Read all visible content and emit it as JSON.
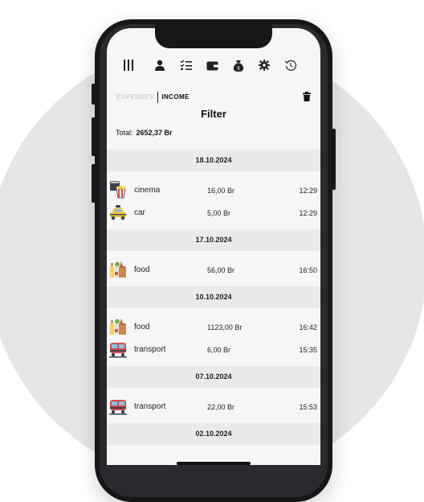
{
  "colors": {
    "accent": "#111111",
    "muted": "#c0c0c0",
    "date_band": "#eaeaeb"
  },
  "toolbar": {
    "icons": [
      "menu-icon",
      "user-icon",
      "checklist-icon",
      "wallet-icon",
      "money-bag-icon",
      "gear-icon",
      "history-icon"
    ]
  },
  "mode": {
    "expenses_label": "EXPENSES",
    "income_label": "INCOME"
  },
  "page_title": "Filter",
  "total": {
    "label": "Total:",
    "amount": "2652,37 Br"
  },
  "groups": [
    {
      "date": "18.10.2024",
      "items": [
        {
          "icon": "cinema-icon",
          "category": "cinema",
          "amount": "16,00 Br",
          "time": "12:29"
        },
        {
          "icon": "taxi-icon",
          "category": "car",
          "amount": "5,00 Br",
          "time": "12:29"
        }
      ]
    },
    {
      "date": "17.10.2024",
      "items": [
        {
          "icon": "grocery-icon",
          "category": "food",
          "amount": "56,00 Br",
          "time": "16:50"
        }
      ]
    },
    {
      "date": "10.10.2024",
      "items": [
        {
          "icon": "grocery-icon",
          "category": "food",
          "amount": "1123,00 Br",
          "time": "16:42"
        },
        {
          "icon": "train-icon",
          "category": "transport",
          "amount": "6,00 Br",
          "time": "15:35"
        }
      ]
    },
    {
      "date": "07.10.2024",
      "items": [
        {
          "icon": "train-icon",
          "category": "transport",
          "amount": "22,00 Br",
          "time": "15:53"
        }
      ]
    },
    {
      "date": "02.10.2024",
      "items": []
    }
  ]
}
